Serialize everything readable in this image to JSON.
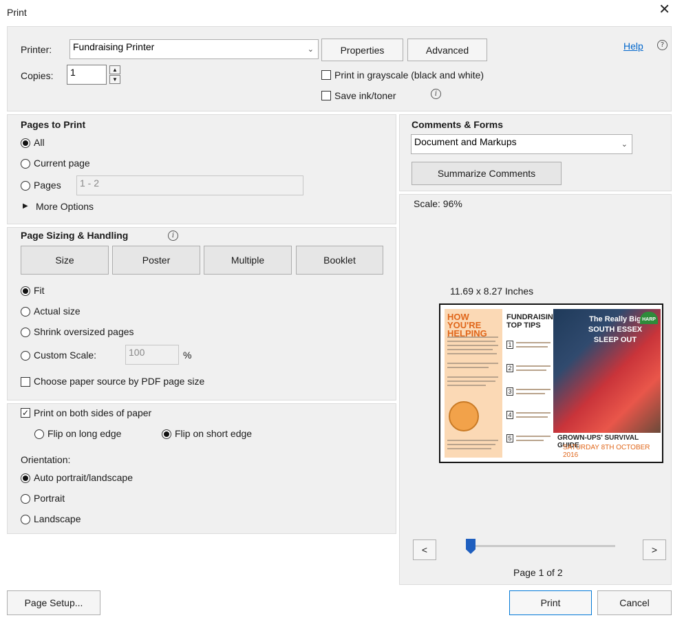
{
  "window": {
    "title": "Print",
    "close_glyph": "✕"
  },
  "top": {
    "printer_label": "Printer:",
    "printer_value": "Fundraising Printer",
    "properties_label": "Properties",
    "advanced_label": "Advanced",
    "help_label": "Help",
    "copies_label": "Copies:",
    "copies_value": "1",
    "grayscale_label": "Print in grayscale (black and white)",
    "save_ink_label": "Save ink/toner"
  },
  "pages_to_print": {
    "heading": "Pages to Print",
    "all_label": "All",
    "current_page_label": "Current page",
    "pages_label": "Pages",
    "pages_value": "1 - 2",
    "more_options_label": "More Options"
  },
  "sizing": {
    "heading": "Page Sizing & Handling",
    "tabs": [
      "Size",
      "Poster",
      "Multiple",
      "Booklet"
    ],
    "fit_label": "Fit",
    "actual_size_label": "Actual size",
    "shrink_label": "Shrink oversized pages",
    "custom_scale_label": "Custom Scale:",
    "custom_scale_value": "100",
    "percent": "%",
    "paper_source_label": "Choose paper source by PDF page size"
  },
  "duplex": {
    "both_sides_label": "Print on both sides of paper",
    "long_edge_label": "Flip on long edge",
    "short_edge_label": "Flip on short edge"
  },
  "orientation": {
    "heading": "Orientation:",
    "auto_label": "Auto portrait/landscape",
    "portrait_label": "Portrait",
    "landscape_label": "Landscape"
  },
  "comments": {
    "heading": "Comments & Forms",
    "value": "Document and Markups",
    "summarize_label": "Summarize Comments"
  },
  "preview": {
    "scale_label": "Scale: 96%",
    "size_label": "11.69 x 8.27 Inches",
    "page_indicator": "Page 1 of 2",
    "prev_glyph": "<",
    "next_glyph": ">",
    "page_position": 0,
    "doc": {
      "heading_left": "HOW YOU'RE HELPING",
      "heading_mid": "FUNDRAISING TOP TIPS",
      "photo_title": "The Really Big SOUTH ESSEX SLEEP OUT",
      "logo": "HARP",
      "footer_title": "GROWN-UPS' SURVIVAL GUIDE",
      "footer_date": "SATURDAY 8TH OCTOBER 2016",
      "tip_numbers": [
        "1",
        "2",
        "3",
        "4",
        "5"
      ]
    }
  },
  "footer": {
    "page_setup_label": "Page Setup...",
    "print_label": "Print",
    "cancel_label": "Cancel"
  },
  "colors": {
    "accent": "#0078d7",
    "link": "#0066cc",
    "panel": "#f0f0f0"
  }
}
